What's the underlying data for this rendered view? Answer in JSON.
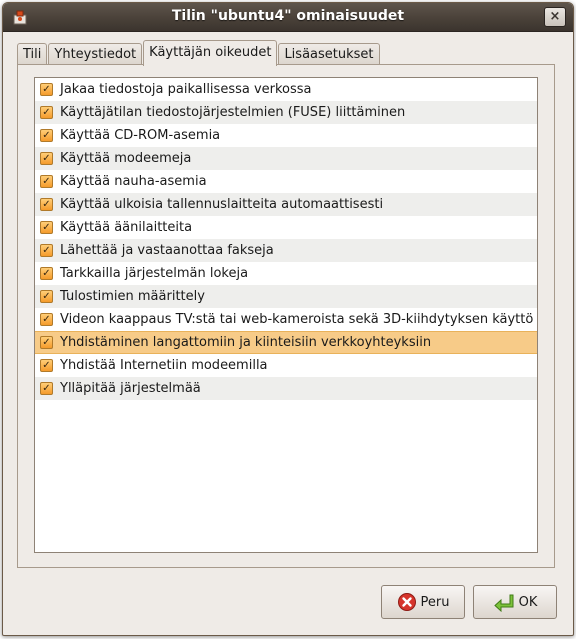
{
  "window": {
    "title": "Tilin \"ubuntu4\" ominaisuudet",
    "close_glyph": "×"
  },
  "tabs": [
    {
      "label": "Tili",
      "active": false
    },
    {
      "label": "Yhteystiedot",
      "active": false
    },
    {
      "label": "Käyttäjän oikeudet",
      "active": true
    },
    {
      "label": "Lisäasetukset",
      "active": false
    }
  ],
  "privileges": [
    {
      "label": "Jakaa tiedostoja paikallisessa verkossa",
      "checked": true
    },
    {
      "label": "Käyttäjätilan tiedostojärjestelmien (FUSE) liittäminen",
      "checked": true
    },
    {
      "label": "Käyttää CD-ROM-asemia",
      "checked": true
    },
    {
      "label": "Käyttää modeemeja",
      "checked": true
    },
    {
      "label": "Käyttää nauha-asemia",
      "checked": true
    },
    {
      "label": "Käyttää ulkoisia tallennuslaitteita automaattisesti",
      "checked": true
    },
    {
      "label": "Käyttää äänilaitteita",
      "checked": true
    },
    {
      "label": "Lähettää ja vastaanottaa fakseja",
      "checked": true
    },
    {
      "label": "Tarkkailla järjestelmän lokeja",
      "checked": true
    },
    {
      "label": "Tulostimien määrittely",
      "checked": true
    },
    {
      "label": "Videon kaappaus TV:stä tai web-kameroista sekä 3D-kiihdytyksen käyttö",
      "checked": true
    },
    {
      "label": "Yhdistäminen langattomiin ja kiinteisiin verkkoyhteyksiin",
      "checked": true
    },
    {
      "label": "Yhdistää Internetiin modeemilla",
      "checked": true
    },
    {
      "label": "Ylläpitää järjestelmää",
      "checked": true
    }
  ],
  "selected_row": 11,
  "buttons": {
    "cancel_label": "Peru",
    "ok_label": "OK"
  },
  "icons": {
    "app": "users-admin-icon",
    "cancel": "cancel-icon",
    "ok": "ok-arrow-icon"
  },
  "colors": {
    "selection": "#f7cb88",
    "checkbox": "#f59b2a",
    "titlebar": "#4a4139",
    "window_bg": "#efebe7"
  }
}
